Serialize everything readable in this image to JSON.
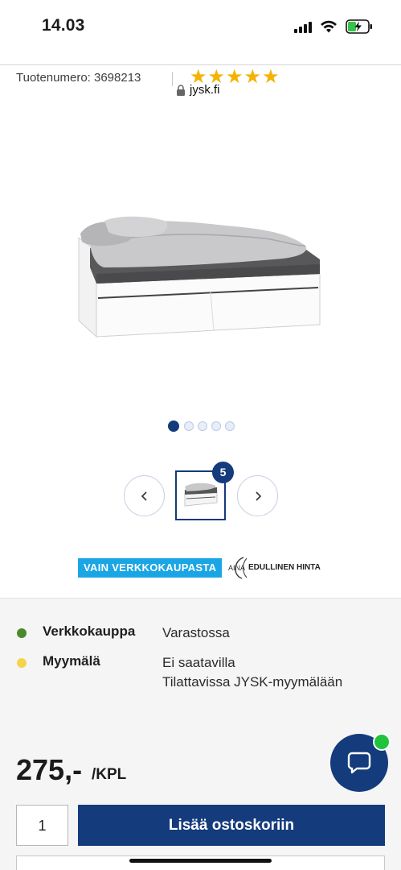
{
  "status_bar": {
    "time": "14.03",
    "icons": [
      "signal-icon",
      "wifi-icon",
      "battery-charging-icon"
    ]
  },
  "browser": {
    "url": "jysk.fi",
    "url_icon": "lock-icon"
  },
  "product": {
    "number_label": "Tuotenumero: 3698213",
    "rating_stars": "★★★★★",
    "rating_value": 5,
    "rating_max": 5,
    "image_icon": "bed-with-drawers-image"
  },
  "gallery": {
    "total_dots": 5,
    "active_dot": 1,
    "thumbnail_count": "5",
    "prev_icon": "chevron-left-icon",
    "next_icon": "chevron-right-icon"
  },
  "badges": {
    "online_only": "VAIN VERKKOKAUPASTA",
    "low_price_prefix": "AINA",
    "low_price_text": "EDULLINEN HINTA"
  },
  "availability": [
    {
      "label": "Verkkokauppa",
      "lines": [
        "Varastossa"
      ],
      "color": "#4a8a2a"
    },
    {
      "label": "Myymälä",
      "lines": [
        "Ei saatavilla",
        "Tilattavissa JYSK-myymälään"
      ],
      "color": "#f3d54a"
    }
  ],
  "pricing": {
    "price": "275,-",
    "unit": "/KPL"
  },
  "cart": {
    "quantity": "1",
    "add_label": "Lisää ostoskoriin"
  },
  "chat": {
    "icon": "chat-bubble-icon",
    "status_color": "#20c33c"
  },
  "colors": {
    "brand_blue": "#143b7c",
    "star_yellow": "#f3b300",
    "online_badge": "#1aa6e4"
  }
}
